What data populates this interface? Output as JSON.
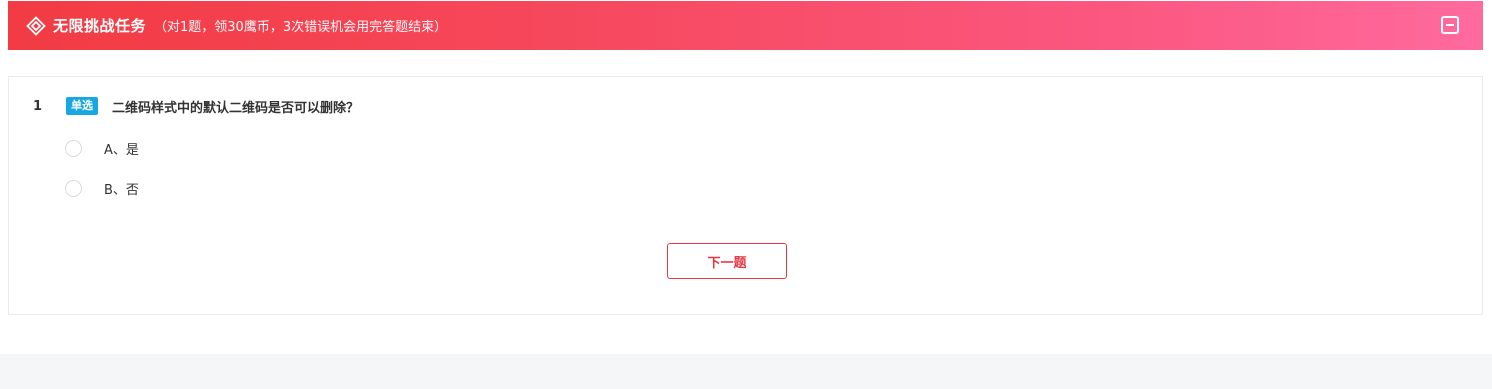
{
  "header": {
    "title": "无限挑战任务",
    "subtitle": "（对1题，领30鹰币，3次错误机会用完答题结束）",
    "logo_icon": "diamond-target-icon",
    "collapse_icon": "minus-square-icon",
    "gradient_start": "#f23b43",
    "gradient_end": "#ff6a9e"
  },
  "question": {
    "number": "1",
    "type_tag": "单选",
    "tag_color": "#19a7e1",
    "text": "二维码样式中的默认二维码是否可以删除？",
    "options": [
      {
        "label": "A、是"
      },
      {
        "label": "B、否"
      }
    ]
  },
  "actions": {
    "next_label": "下一题",
    "accent": "#e23b45"
  }
}
